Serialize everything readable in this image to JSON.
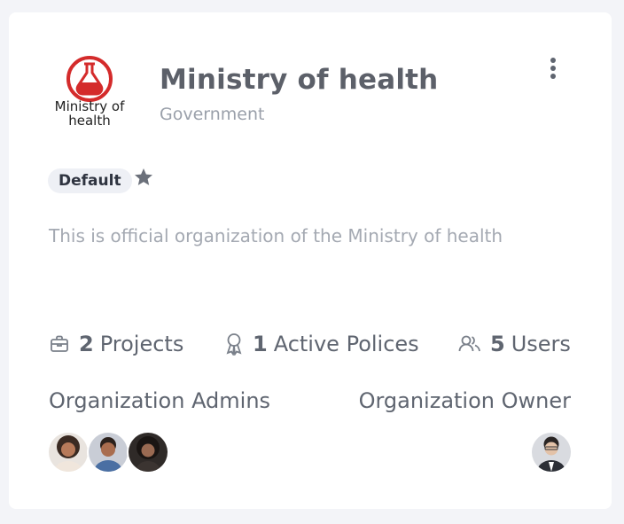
{
  "organization": {
    "name": "Ministry of health",
    "type": "Government",
    "logo_text_line1": "Ministry of",
    "logo_text_line2": "health",
    "badge": "Default",
    "description": "This is official organization of the Ministry of health"
  },
  "stats": {
    "projects": {
      "count": "2",
      "label": "Projects",
      "icon": "briefcase-icon"
    },
    "policies": {
      "count": "1",
      "label": "Active Polices",
      "icon": "ribbon-icon"
    },
    "users": {
      "count": "5",
      "label": "Users",
      "icon": "users-icon"
    }
  },
  "sections": {
    "admins_label": "Organization Admins",
    "owner_label": "Organization Owner"
  },
  "colors": {
    "logo_red": "#d42b2b",
    "text": "#5f6570",
    "muted": "#9aa0aa",
    "badge_bg": "#eef0f5",
    "card_bg": "#ffffff",
    "page_bg": "#f3f4f8"
  }
}
